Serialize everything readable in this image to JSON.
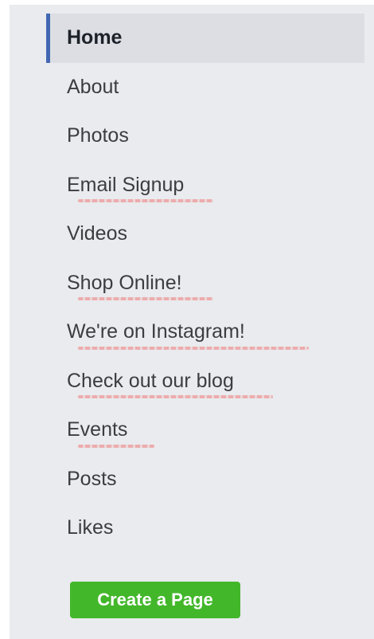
{
  "nav": {
    "items": [
      {
        "label": "Home",
        "active": true
      },
      {
        "label": "About"
      },
      {
        "label": "Photos"
      },
      {
        "label": "Email Signup"
      },
      {
        "label": "Videos"
      },
      {
        "label": "Shop Online!"
      },
      {
        "label": "We're on Instagram!"
      },
      {
        "label": "Check out our blog"
      },
      {
        "label": "Events"
      },
      {
        "label": "Posts"
      },
      {
        "label": "Likes"
      }
    ]
  },
  "create_page_label": "Create a Page",
  "colors": {
    "panel_background": "#e9ebee",
    "active_indicator": "#4267b2",
    "button_green": "#42b72a",
    "spellcheck_underline": "#f08282"
  }
}
